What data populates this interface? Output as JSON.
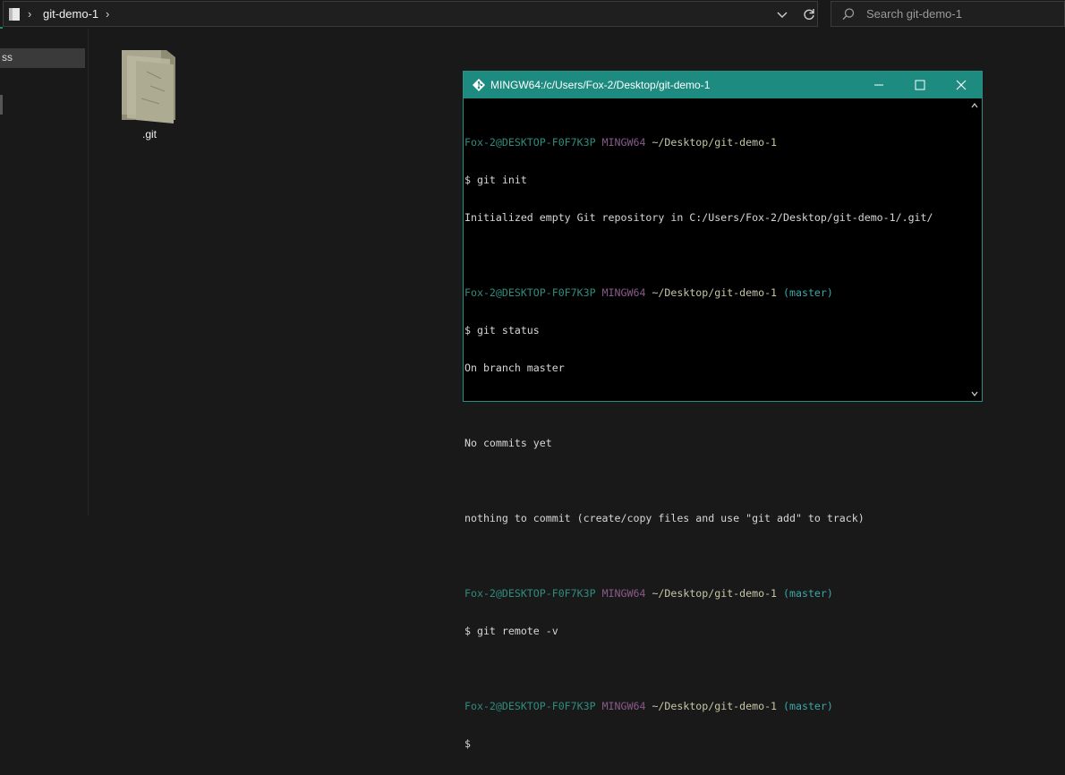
{
  "explorer": {
    "breadcrumb": "git-demo-1",
    "search_placeholder": "Search git-demo-1",
    "nav_selected_label": "ss",
    "file_name": ".git"
  },
  "terminal": {
    "title": "MINGW64:/c/Users/Fox-2/Desktop/git-demo-1",
    "accent_color": "#1d8b80",
    "prompt_user": "Fox-2@DESKTOP-F0F7K3P",
    "prompt_host": "MINGW64",
    "prompt_path": "~/Desktop/git-demo-1",
    "branch": "(master)",
    "lines": {
      "cmd1": "$ git init",
      "out1": "Initialized empty Git repository in C:/Users/Fox-2/Desktop/git-demo-1/.git/",
      "cmd2": "$ git status",
      "out2a": "On branch master",
      "out2b": "No commits yet",
      "out2c": "nothing to commit (create/copy files and use \"git add\" to track)",
      "cmd3": "$ git remote -v",
      "cmd4": "$"
    }
  },
  "icons": [
    "folder-icon",
    "chevron-right-icon",
    "chevron-down-icon",
    "refresh-icon",
    "search-icon",
    "git-icon",
    "minimize-icon",
    "maximize-icon",
    "close-icon",
    "scroll-up-icon",
    "scroll-down-icon"
  ]
}
